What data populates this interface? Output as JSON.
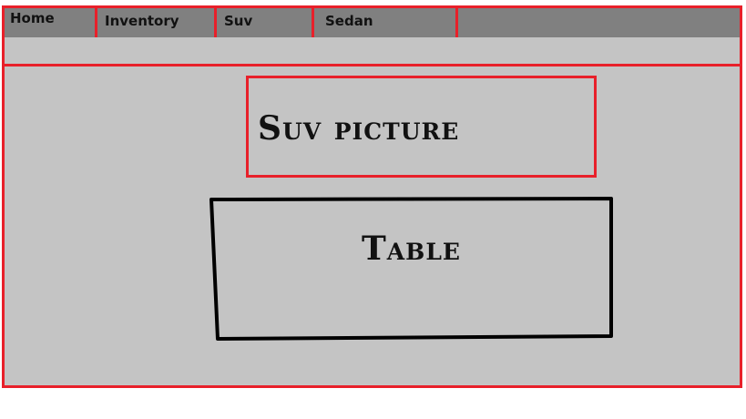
{
  "nav": {
    "items": [
      {
        "label": "Home"
      },
      {
        "label": "Inventory"
      },
      {
        "label": "Suv"
      },
      {
        "label": "Sedan"
      }
    ]
  },
  "main": {
    "picture_label": "Suv picture",
    "table_label": "Table"
  },
  "colors": {
    "outline": "#e8202a",
    "navbar_bg": "#808080",
    "content_bg": "#c4c4c4",
    "ink": "#111111"
  }
}
